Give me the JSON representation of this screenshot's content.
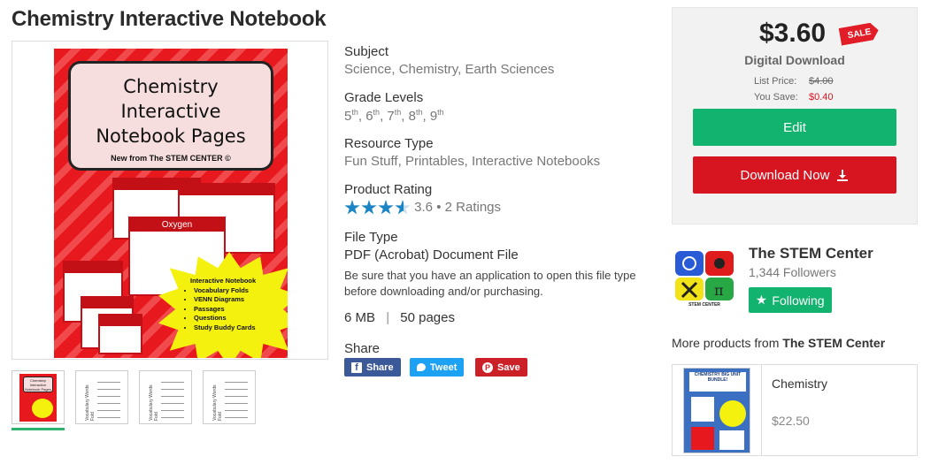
{
  "product": {
    "title": "Chemistry Interactive Notebook"
  },
  "cover": {
    "title_line1": "Chemistry",
    "title_line2": "Interactive",
    "title_line3": "Notebook Pages",
    "subtitle": "New from The STEM CENTER ©",
    "oxygen_label": "Oxygen",
    "burst_items": [
      "Interactive Notebook",
      "Vocabulary Folds",
      "VENN Diagrams",
      "Passages",
      "Questions",
      "Study Buddy Cards"
    ]
  },
  "thumbnails": [
    {
      "kind": "cover"
    },
    {
      "kind": "sheet",
      "caption": "Vocabulary Words Fold"
    },
    {
      "kind": "sheet",
      "caption": "Vocabulary Words Fold"
    },
    {
      "kind": "sheet",
      "caption": "Vocabulary Words Fold"
    }
  ],
  "details": {
    "subject_label": "Subject",
    "subjects": [
      "Science",
      "Chemistry",
      "Earth Sciences"
    ],
    "grade_label": "Grade Levels",
    "grades": [
      {
        "n": "5",
        "s": "th"
      },
      {
        "n": "6",
        "s": "th"
      },
      {
        "n": "7",
        "s": "th"
      },
      {
        "n": "8",
        "s": "th"
      },
      {
        "n": "9",
        "s": "th"
      }
    ],
    "resource_label": "Resource Type",
    "resources": [
      "Fun Stuff",
      "Printables",
      "Interactive Notebooks"
    ],
    "rating_label": "Product Rating",
    "rating": "3.6",
    "rating_value": 3.6,
    "rating_count": "2 Ratings",
    "filetype_label": "File Type",
    "filetype": "PDF (Acrobat) Document File",
    "filetype_note": "Be sure that you have an application to open this file type before downloading and/or purchasing.",
    "size": "6 MB",
    "pages": "50 pages",
    "share_label": "Share",
    "share_facebook": "Share",
    "share_twitter": "Tweet",
    "share_pinterest": "Save"
  },
  "buy": {
    "price": "$3.60",
    "sale_tag": "SALE",
    "format": "Digital Download",
    "list_price_label": "List Price:",
    "list_price": "$4.00",
    "you_save_label": "You Save:",
    "you_save": "$0.40",
    "edit_label": "Edit",
    "download_label": "Download Now"
  },
  "store": {
    "name": "The STEM Center",
    "followers": "1,344 Followers",
    "follow_label": "Following",
    "logo_caption": "STEM CENTER"
  },
  "more": {
    "prefix": "More products from ",
    "store": "The STEM Center",
    "product_title": "Chemistry",
    "product_price": "$22.50",
    "product_image_text": "CHEMISTRY BIG UNIT BUNDLE!"
  },
  "colors": {
    "green": "#12b36e",
    "red": "#d61520",
    "blue_star": "#1a84c4",
    "facebook": "#3b5998",
    "twitter": "#1da1f2",
    "pinterest": "#cb2027"
  }
}
